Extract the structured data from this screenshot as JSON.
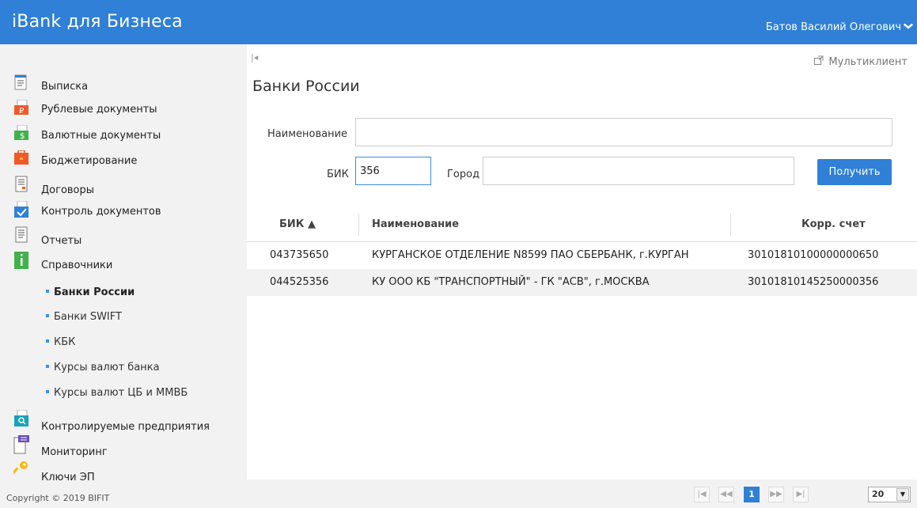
{
  "header": {
    "app_title": "iBank для Бизнеса",
    "user_name": "Батов Василий Олегович",
    "color": "#2f80d6"
  },
  "sidebar": {
    "items": [
      {
        "label": "Выписка",
        "icon": "statement-icon"
      },
      {
        "label": "Рублевые документы",
        "icon": "ruble-documents-icon"
      },
      {
        "label": "Валютные документы",
        "icon": "currency-documents-icon"
      },
      {
        "label": "Бюджетирование",
        "icon": "budget-icon"
      },
      {
        "label": "Договоры",
        "icon": "contracts-icon"
      },
      {
        "label": "Контроль документов",
        "icon": "document-control-icon"
      },
      {
        "label": "Отчеты",
        "icon": "reports-icon"
      },
      {
        "label": "Справочники",
        "icon": "reference-books-icon"
      }
    ],
    "subitems": [
      {
        "label": "Банки России",
        "active": true
      },
      {
        "label": "Банки SWIFT"
      },
      {
        "label": "КБК"
      },
      {
        "label": "Курсы валют банка"
      },
      {
        "label": "Курсы валют ЦБ и ММВБ"
      }
    ],
    "items_after": [
      {
        "label": "Контролируемые предприятия",
        "icon": "controlled-companies-icon"
      },
      {
        "label": "Мониторинг",
        "icon": "monitoring-icon"
      },
      {
        "label": "Ключи ЭП",
        "icon": "key-icon"
      }
    ],
    "copyright": "Copyright © 2019 BIFIT"
  },
  "main": {
    "multiclient_label": "Мультиклиент",
    "page_title": "Банки России",
    "form": {
      "name_label": "Наименование",
      "name_value": "",
      "bik_label": "БИК",
      "bik_value": "356",
      "city_label": "Город",
      "city_value": "",
      "submit_label": "Получить"
    },
    "table": {
      "columns": [
        "БИК ▲",
        "Наименование",
        "Корр. счет"
      ],
      "rows": [
        {
          "bik": "043735650",
          "name": "КУРГАНСКОЕ ОТДЕЛЕНИЕ N8599 ПАО СБЕРБАНК, г.КУРГАН",
          "account": "30101810100000000650"
        },
        {
          "bik": "044525356",
          "name": "КУ ООО КБ \"ТРАНСПОРТНЫЙ\" - ГК \"АСВ\", г.МОСКВА",
          "account": "30101810145250000356"
        }
      ]
    },
    "pager": {
      "first": "|◀",
      "prev": "◀◀",
      "current_page": "1",
      "next": "▶▶",
      "last": "▶|",
      "page_size": "20"
    }
  }
}
